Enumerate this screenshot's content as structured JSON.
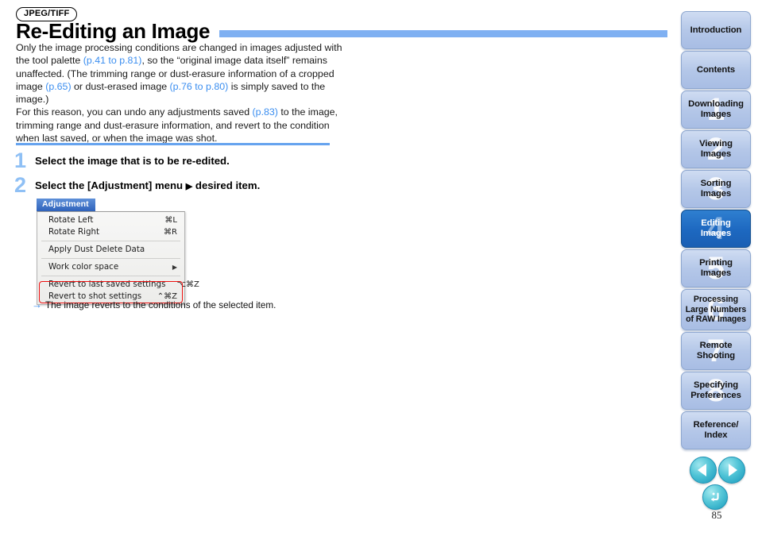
{
  "document": {
    "format_badge": "JPEG/TIFF",
    "title": "Re-Editing an Image",
    "page_number": "85"
  },
  "body": {
    "para1_a": "Only the image processing conditions are changed in images adjusted with the tool palette ",
    "link1": "(p.41 to p.81)",
    "para1_b": ", so the “original image data itself” remains unaffected. (The trimming range or dust-erasure information of a cropped image ",
    "link2": "(p.65)",
    "para1_c": " or dust-erased image ",
    "link3": "(p.76 to p.80)",
    "para1_d": " is simply saved to the image.)",
    "para2_a": "For this reason, you can undo any adjustments saved ",
    "link4": "(p.83)",
    "para2_b": " to the image, trimming range and dust-erasure information, and revert to the condition when last saved, or when the image was shot."
  },
  "steps": [
    {
      "num": "1",
      "text": "Select the image that is to be re-edited."
    },
    {
      "num": "2",
      "text_a": "Select the [Adjustment] menu ",
      "arrow": "▶",
      "text_b": " desired item."
    }
  ],
  "menu": {
    "title": "Adjustment",
    "items": [
      {
        "label": "Rotate Left",
        "shortcut": "⌘L"
      },
      {
        "label": "Rotate Right",
        "shortcut": "⌘R"
      },
      {
        "label": "Apply Dust Delete Data",
        "shortcut": ""
      },
      {
        "label": "Work color space",
        "shortcut": "",
        "submenu": "▶"
      },
      {
        "label": "Revert to last saved settings",
        "shortcut": "⌥⌘Z"
      },
      {
        "label": "Revert to shot settings",
        "shortcut": "⌃⌘Z"
      }
    ],
    "highlight_color": "#ee1111"
  },
  "result_note": {
    "arrow": "→",
    "text": "The image reverts to the conditions of the selected item."
  },
  "sidebar": {
    "tabs": [
      {
        "label": "Introduction",
        "watermark": "",
        "active": false
      },
      {
        "label": "Contents",
        "watermark": "",
        "active": false
      },
      {
        "label": "Downloading\nImages",
        "watermark": "1",
        "active": false
      },
      {
        "label": "Viewing\nImages",
        "watermark": "2",
        "active": false
      },
      {
        "label": "Sorting\nImages",
        "watermark": "3",
        "active": false
      },
      {
        "label": "Editing\nImages",
        "watermark": "4",
        "active": true
      },
      {
        "label": "Printing\nImages",
        "watermark": "5",
        "active": false
      },
      {
        "label": "Processing\nLarge Numbers\nof RAW Images",
        "watermark": "6",
        "active": false
      },
      {
        "label": "Remote\nShooting",
        "watermark": "7",
        "active": false
      },
      {
        "label": "Specifying\nPreferences",
        "watermark": "8",
        "active": false
      },
      {
        "label": "Reference/\nIndex",
        "watermark": "",
        "active": false
      }
    ]
  },
  "nav": {
    "prev_label": "Previous page",
    "next_label": "Next page",
    "return_label": "Return"
  },
  "colors": {
    "accent_blue": "#7fb0f2",
    "link_blue": "#3b8ef0",
    "active_tab": "#1d68c0",
    "inactive_tab": "#b4c7e8",
    "highlight_red": "#ee1111",
    "teal_button": "#1898bb"
  }
}
